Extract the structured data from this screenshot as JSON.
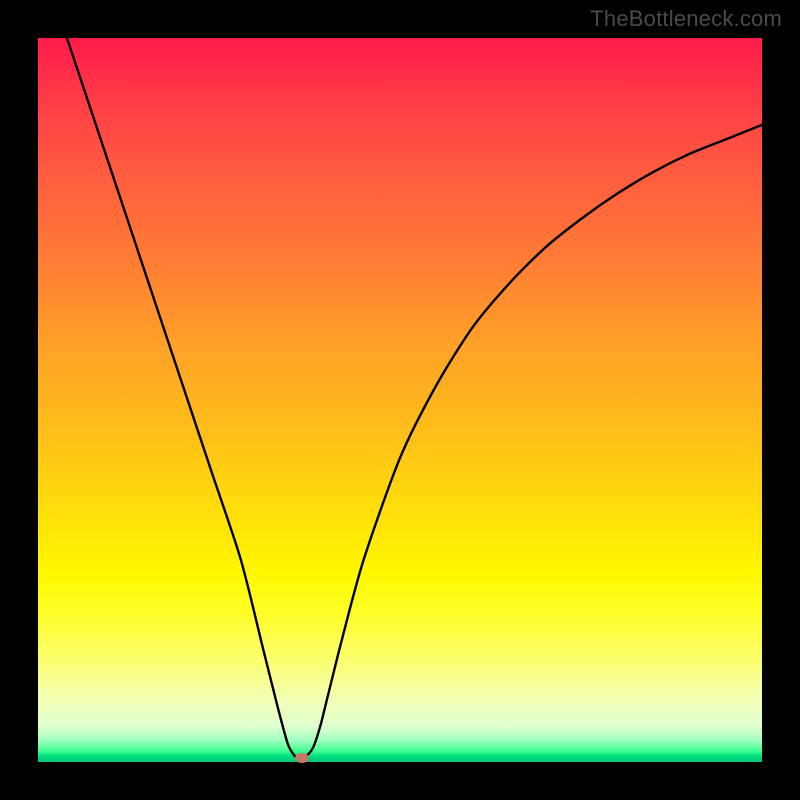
{
  "watermark": "TheBottleneck.com",
  "chart_data": {
    "type": "line",
    "title": "",
    "xlabel": "",
    "ylabel": "",
    "xlim": [
      0,
      100
    ],
    "ylim": [
      0,
      100
    ],
    "series": [
      {
        "name": "bottleneck-curve",
        "x": [
          4,
          8,
          12,
          16,
          20,
          24,
          28,
          31,
          33,
          34.5,
          35.5,
          36,
          37,
          38,
          39,
          40,
          42,
          45,
          50,
          55,
          60,
          65,
          70,
          75,
          80,
          85,
          90,
          95,
          100
        ],
        "values": [
          100,
          88,
          76,
          64,
          52,
          40,
          28,
          16,
          8,
          2.5,
          0.8,
          0.5,
          0.8,
          2,
          5,
          9,
          17,
          28,
          42,
          52,
          60,
          66,
          71,
          75,
          78.5,
          81.5,
          84,
          86,
          88
        ]
      }
    ],
    "marker": {
      "x": 36.5,
      "y": 0.5,
      "color": "#c47a68"
    },
    "gradient_stops": [
      {
        "pos": 0,
        "color": "#ff1a4a"
      },
      {
        "pos": 50,
        "color": "#ffc018"
      },
      {
        "pos": 80,
        "color": "#fff800"
      },
      {
        "pos": 100,
        "color": "#00c878"
      }
    ]
  }
}
